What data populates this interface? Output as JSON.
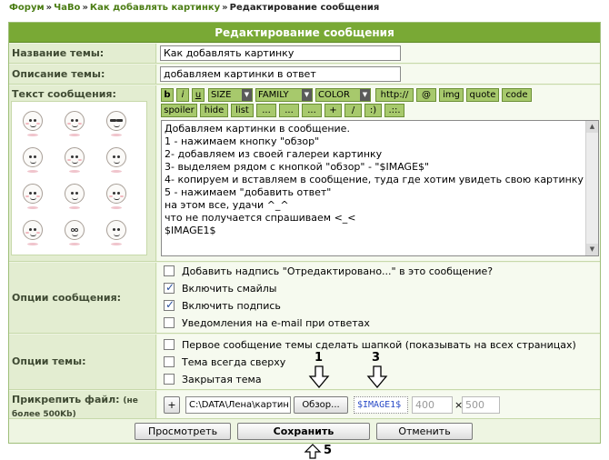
{
  "breadcrumb": {
    "items": [
      "Форум",
      "ЧаВо",
      "Как добавлять картинку"
    ],
    "separator": "»",
    "current": "Редактирование сообщения"
  },
  "header": {
    "title": "Редактирование сообщения"
  },
  "fields": {
    "topic_name_label": "Название темы:",
    "topic_name_value": "Как добавлять картинку",
    "topic_desc_label": "Описание темы:",
    "topic_desc_value": "добавляем картинки в ответ",
    "message_label": "Текст сообщения:"
  },
  "toolbar": {
    "row1": [
      "b",
      "i",
      "u"
    ],
    "selects": [
      "SIZE",
      "FAMILY",
      "COLOR"
    ],
    "row1_tail": [
      "http://",
      "@",
      "img",
      "quote",
      "code"
    ],
    "row2": [
      "spoiler",
      "hide",
      "list",
      "...",
      "...",
      "...",
      "+",
      "/",
      ":)",
      ".::."
    ]
  },
  "message_lines": [
    "Добавляем картинки в сообщение.",
    "1 - нажимаем кнопку \"обзор\"",
    "2- добавляем из своей галереи картинку",
    "3- выделяем рядом с кнопкой \"обзор\" - \"$IMAGE$\"",
    "4- копируем и вставляем в сообщение, туда где хотим увидеть свою картинку",
    "5 - нажимаем \"добавить ответ\"",
    "на этом все, удачи ^_^",
    "что не получается спрашиваем <_<",
    "$IMAGE1$"
  ],
  "message_options": {
    "label": "Опции сообщения:",
    "items": [
      {
        "label": "Добавить надпись \"Отредактировано...\" в это сообщение?",
        "checked": false
      },
      {
        "label": "Включить смайлы",
        "checked": true
      },
      {
        "label": "Включить подпись",
        "checked": true
      },
      {
        "label": "Уведомления на e-mail при ответах",
        "checked": false
      }
    ]
  },
  "topic_options": {
    "label": "Опции темы:",
    "items": [
      {
        "label": "Первое сообщение темы сделать шапкой (показывать на всех страницах)",
        "checked": false
      },
      {
        "label": "Тема всегда сверху",
        "checked": false
      },
      {
        "label": "Закрытая тема",
        "checked": false
      }
    ]
  },
  "attach": {
    "label": "Прикрепить файл:",
    "note": "(не более 500Kb)",
    "add_button": "+",
    "file_path": "C:\\DATA\\Лена\\картин",
    "browse_button": "Обзор...",
    "image_tag": "$IMAGE1$",
    "width": "400",
    "times": "×",
    "height": "500"
  },
  "actions": {
    "preview": "Просмотреть",
    "save": "Сохранить",
    "cancel": "Отменить"
  },
  "annotations": {
    "a1": "1",
    "a3": "3",
    "a5": "5"
  },
  "colors": {
    "header_bg": "#79a935",
    "link": "#4b7d14",
    "panel_bg": "#eef5e2"
  }
}
